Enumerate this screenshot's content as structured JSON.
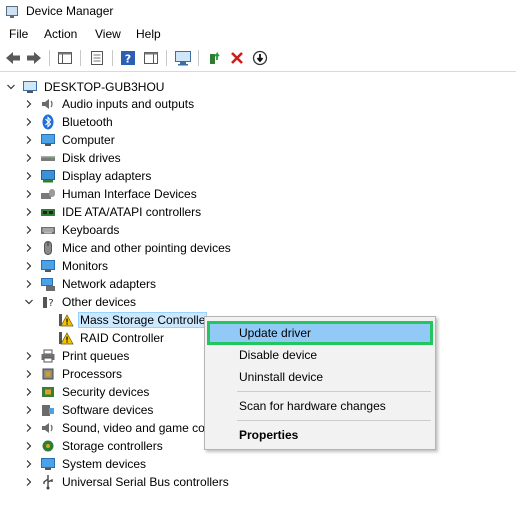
{
  "window": {
    "title": "Device Manager"
  },
  "menu": [
    "File",
    "Action",
    "View",
    "Help"
  ],
  "tree": {
    "root": "DESKTOP-GUB3HOU",
    "categories": [
      "Audio inputs and outputs",
      "Bluetooth",
      "Computer",
      "Disk drives",
      "Display adapters",
      "Human Interface Devices",
      "IDE ATA/ATAPI controllers",
      "Keyboards",
      "Mice and other pointing devices",
      "Monitors",
      "Network adapters",
      "Other devices",
      "Mass Storage Controlle",
      "RAID Controller",
      "Print queues",
      "Processors",
      "Security devices",
      "Software devices",
      "Sound, video and game co",
      "Storage controllers",
      "System devices",
      "Universal Serial Bus controllers"
    ]
  },
  "context_menu": {
    "items": [
      "Update driver",
      "Disable device",
      "Uninstall device",
      "Scan for hardware changes",
      "Properties"
    ]
  },
  "colors": {
    "selection": "#cce8ff",
    "highlight_border": "#22c55e",
    "menu_hover": "#91c9f7"
  }
}
